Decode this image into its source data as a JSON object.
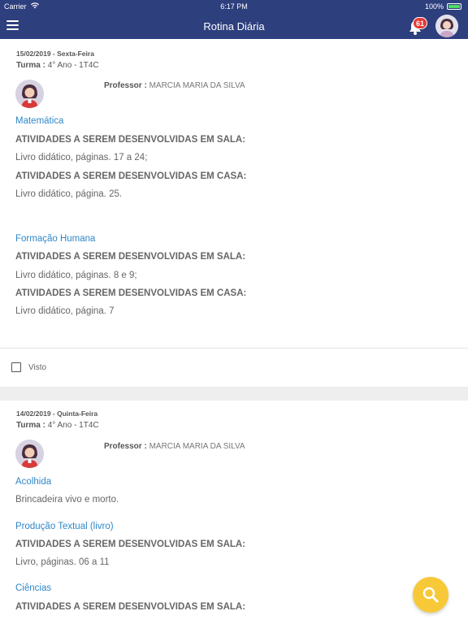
{
  "status_bar": {
    "carrier": "Carrier",
    "time": "6:17 PM",
    "battery": "100%",
    "battery_level": 1.0
  },
  "nav": {
    "title": "Rotina Diária",
    "notification_count": "61"
  },
  "entries": [
    {
      "date": "15/02/2019 - Sexta-Feira",
      "turma_label": "Turma :",
      "turma_value": "4° Ano - 1T4C",
      "professor_label": "Professor :",
      "professor_name": "MARCIA MARIA DA SILVA",
      "subjects": [
        {
          "name": "Matemática",
          "sala_heading": "ATIVIDADES A SEREM DESENVOLVIDAS EM SALA:",
          "sala_text": "Livro didático, páginas. 17 a 24;",
          "casa_heading": "ATIVIDADES A SEREM DESENVOLVIDAS EM CASA:",
          "casa_text": "Livro didático, página. 25."
        },
        {
          "name": "Formação Humana",
          "sala_heading": "ATIVIDADES A SEREM DESENVOLVIDAS EM SALA:",
          "sala_text": "Livro didático, páginas. 8 e 9;",
          "casa_heading": "ATIVIDADES A SEREM DESENVOLVIDAS EM CASA:",
          "casa_text": "Livro didático, página. 7"
        }
      ],
      "visto_label": "Visto"
    },
    {
      "date": "14/02/2019 - Quinta-Feira",
      "turma_label": "Turma :",
      "turma_value": "4° Ano - 1T4C",
      "professor_label": "Professor :",
      "professor_name": "MARCIA MARIA DA SILVA",
      "subjects": [
        {
          "name": "Acolhida",
          "text": "Brincadeira vivo e morto."
        },
        {
          "name": "Produção Textual (livro)",
          "sala_heading": "ATIVIDADES A SEREM DESENVOLVIDAS EM SALA:",
          "sala_text": "Livro, páginas. 06 a 11"
        },
        {
          "name": "Ciências",
          "sala_heading": "ATIVIDADES A SEREM DESENVOLVIDAS EM SALA:"
        }
      ]
    }
  ],
  "colors": {
    "navbar": "#2e3f7e",
    "subject": "#2f87c8",
    "fab": "#f7c938",
    "badge": "#e53935"
  },
  "icons": {
    "menu": "hamburger-icon",
    "notifications": "bell-icon",
    "search": "search-icon"
  }
}
